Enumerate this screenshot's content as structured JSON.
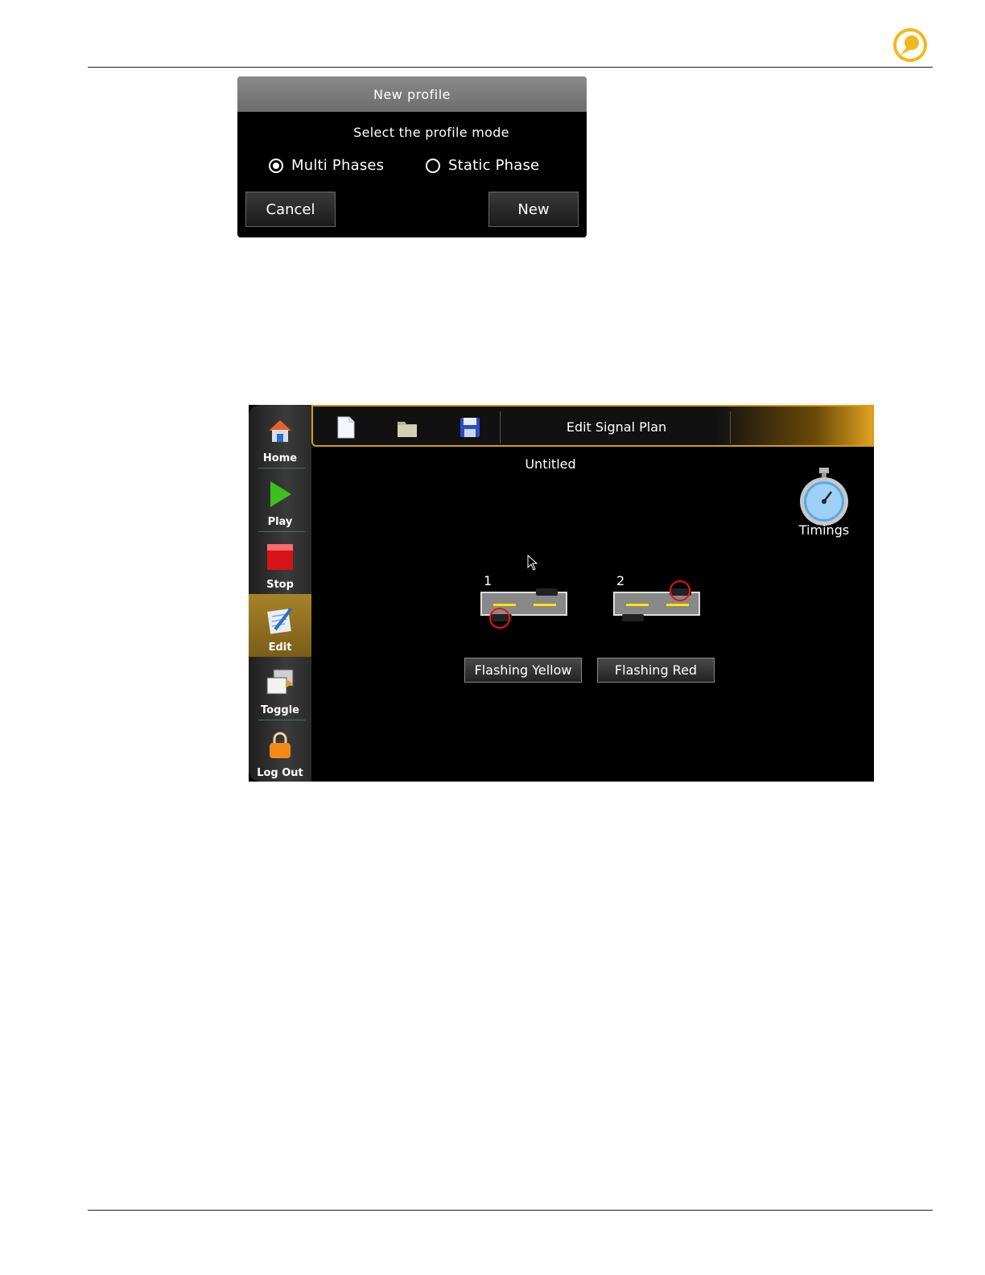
{
  "dialog": {
    "title": "New profile",
    "prompt": "Select the profile mode",
    "options": [
      {
        "label": "Multi Phases",
        "selected": true
      },
      {
        "label": "Static Phase",
        "selected": false
      }
    ],
    "cancel_label": "Cancel",
    "new_label": "New"
  },
  "screen": {
    "sidebar": {
      "items": [
        {
          "label": "Home",
          "icon": "home-icon"
        },
        {
          "label": "Play",
          "icon": "play-icon"
        },
        {
          "label": "Stop",
          "icon": "stop-icon"
        },
        {
          "label": "Edit",
          "icon": "edit-icon",
          "active": true
        },
        {
          "label": "Toggle",
          "icon": "toggle-icon"
        },
        {
          "label": "Log Out",
          "icon": "lock-icon"
        }
      ]
    },
    "toolbar": {
      "title": "Edit Signal Plan",
      "icons": [
        "new-file-icon",
        "open-folder-icon",
        "save-icon"
      ]
    },
    "plan_name": "Untitled",
    "timings_label": "Timings",
    "phases": [
      {
        "number": "1",
        "button_label": "Flashing Yellow"
      },
      {
        "number": "2",
        "button_label": "Flashing Red"
      }
    ]
  },
  "colors": {
    "accent": "#d79a16",
    "active_item": "#a7822a",
    "lane_marking": "#ffe400",
    "highlight_circle": "#e11111"
  }
}
